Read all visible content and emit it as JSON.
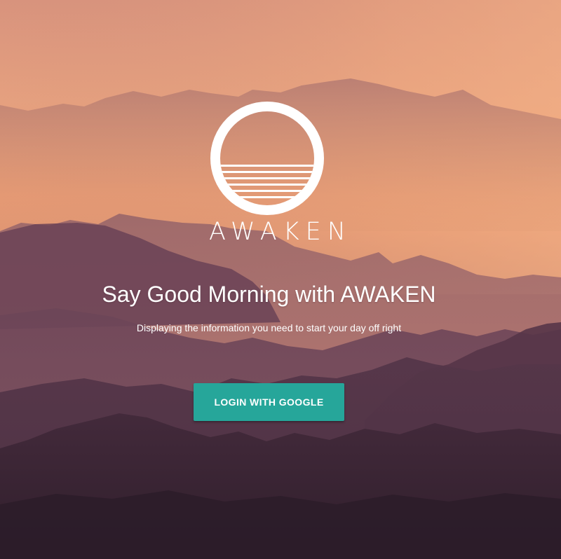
{
  "brand": {
    "name": "AWAKEN",
    "logo_icon": "sunset-circle-icon"
  },
  "hero": {
    "headline": "Say Good Morning with AWAKEN",
    "subheadline": "Displaying the information you need to start your day off right"
  },
  "actions": {
    "login_label": "LOGIN WITH GOOGLE"
  },
  "colors": {
    "accent": "#26a69a",
    "sky_top": "#d98a74",
    "sky_mid": "#f0a67c",
    "mountain_dark": "#3e2838",
    "text": "#ffffff"
  }
}
